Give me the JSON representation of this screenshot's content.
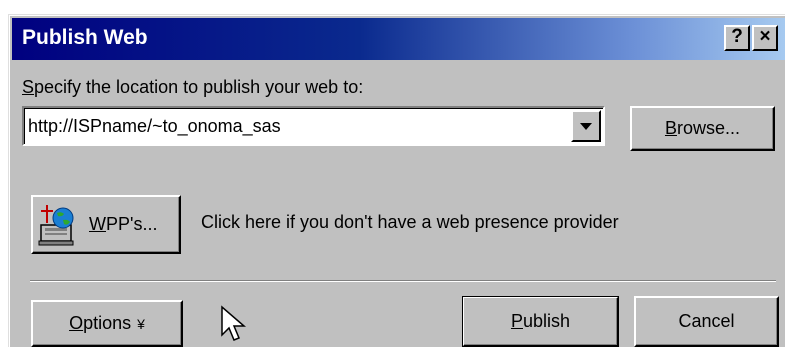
{
  "window": {
    "title": "Publish Web",
    "help_label": "?",
    "close_label": "×"
  },
  "location": {
    "label_mnemonic": "S",
    "label_rest": "pecify the location to publish your web to:",
    "url_value": "http://ISPname/~to_onoma_sas"
  },
  "buttons": {
    "browse_mnemonic": "B",
    "browse_rest": "rowse...",
    "wpp_mnemonic": "W",
    "wpp_rest": "PP's...",
    "options_mnemonic": "O",
    "options_rest": "ptions",
    "options_arrow": "¥",
    "publish_mnemonic": "P",
    "publish_rest": "ublish",
    "cancel": "Cancel"
  },
  "wpp": {
    "info_text": "Click here if you don't have a web presence provider",
    "icon": "globe-computer-icon"
  },
  "colors": {
    "titlebar_start": "#000080",
    "titlebar_end": "#a6caf0",
    "dialog_face": "#c0c0c0"
  }
}
